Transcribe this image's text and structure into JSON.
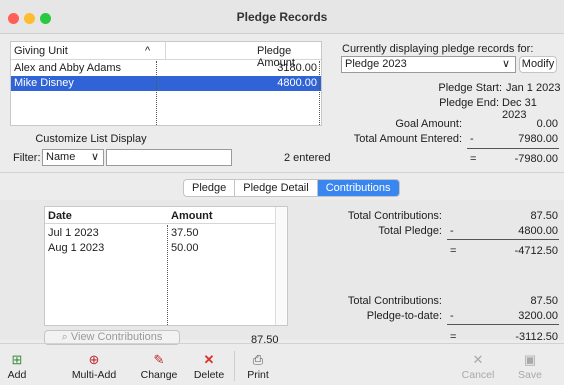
{
  "window": {
    "title": "Pledge Records"
  },
  "list": {
    "col_giving_unit": "Giving Unit",
    "sort_indicator": "^",
    "col_pledge_amount": "Pledge Amount",
    "rows": [
      {
        "name": "Alex and Abby Adams",
        "amount": "3180.00"
      },
      {
        "name": "Mike Disney",
        "amount": "4800.00"
      }
    ]
  },
  "customize_label": "Customize List Display",
  "filter": {
    "label": "Filter:",
    "value": "Name"
  },
  "entered_count": "2 entered",
  "right": {
    "displaying_label": "Currently displaying pledge records for:",
    "campaign": "Pledge 2023",
    "modify_label": "Modify",
    "start_label": "Pledge Start:",
    "start_value": "Jan 1 2023",
    "end_label": "Pledge End:",
    "end_value": "Dec 31 2023",
    "goal_label": "Goal Amount:",
    "goal_value": "0.00",
    "total_entered_label": "Total Amount Entered:",
    "minus": "-",
    "total_entered_value": "7980.00",
    "equals": "=",
    "diff_value": "-7980.00"
  },
  "tabs": {
    "pledge": "Pledge",
    "detail": "Pledge Detail",
    "contributions": "Contributions"
  },
  "contrib": {
    "col_date": "Date",
    "col_amount": "Amount",
    "rows": [
      {
        "date": "Jul 1 2023",
        "amount": "37.50"
      },
      {
        "date": "Aug 1 2023",
        "amount": "50.00"
      }
    ],
    "view_label": "View Contributions",
    "total": "87.50"
  },
  "summary": {
    "tc_label": "Total Contributions:",
    "tc_value": "87.50",
    "tp_label": "Total Pledge:",
    "minus": "-",
    "tp_value": "4800.00",
    "equals": "=",
    "diff1": "-4712.50",
    "tc2_label": "Total Contributions:",
    "tc2_value": "87.50",
    "ptd_label": "Pledge-to-date:",
    "ptd_value": "3200.00",
    "diff2": "-3112.50"
  },
  "toolbar": {
    "add": "Add",
    "multi_add": "Multi-Add",
    "change": "Change",
    "delete": "Delete",
    "print": "Print",
    "cancel": "Cancel",
    "save": "Save"
  },
  "colors": {
    "selection": "#2f63d6",
    "tab_active": "#3a86f0",
    "close": "#fe5f57",
    "minimize": "#febc2e",
    "zoom": "#28c840",
    "delete_red": "#d9302a"
  }
}
